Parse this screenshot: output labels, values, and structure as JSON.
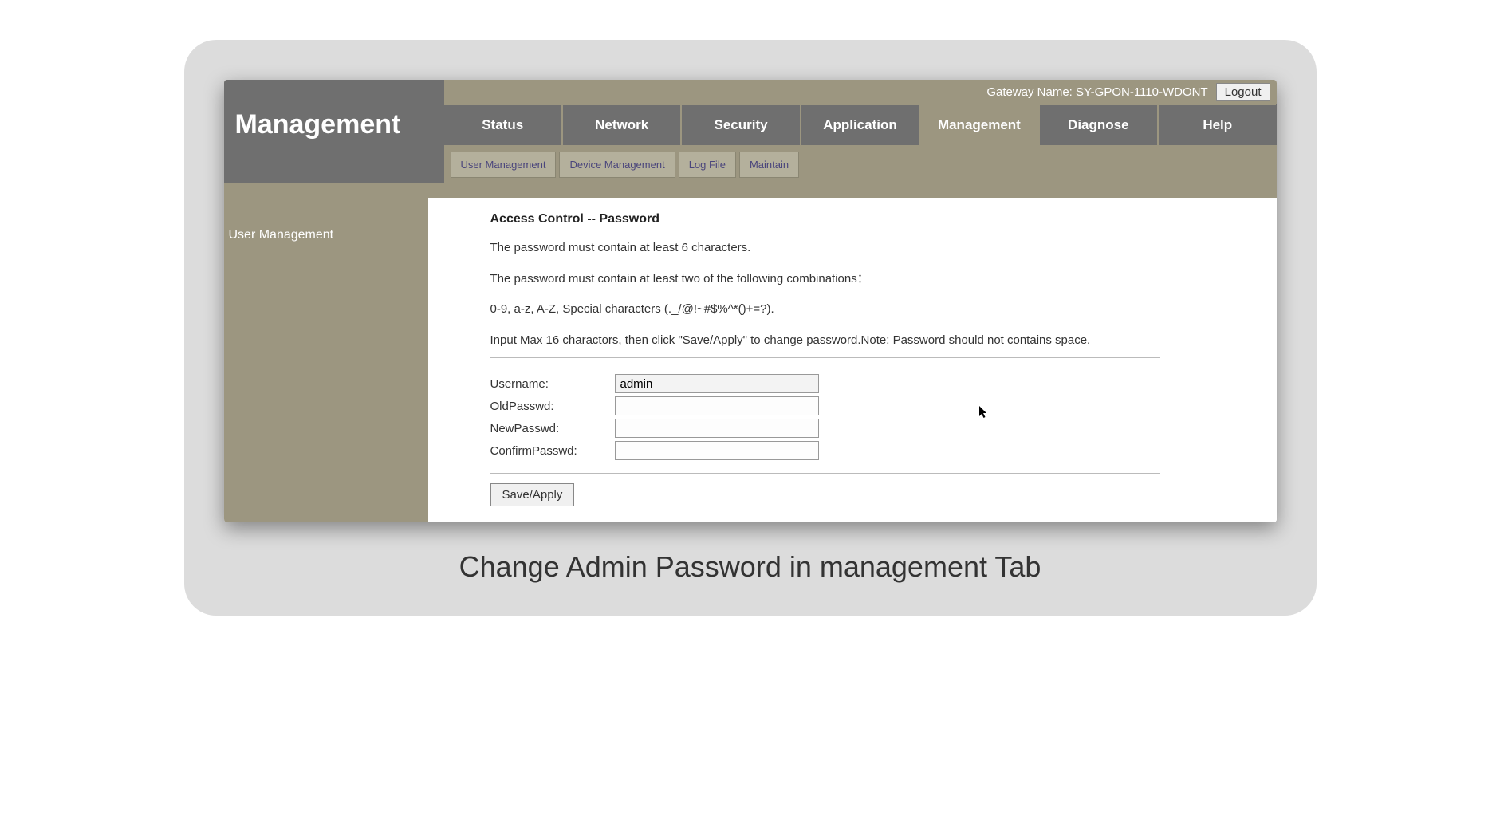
{
  "header": {
    "gateway_label": "Gateway Name: SY-GPON-1110-WDONT",
    "logout": "Logout",
    "title": "Management"
  },
  "main_nav": {
    "status": "Status",
    "network": "Network",
    "security": "Security",
    "application": "Application",
    "management": "Management",
    "diagnose": "Diagnose",
    "help": "Help"
  },
  "sub_nav": {
    "user_management": "User Management",
    "device_management": "Device Management",
    "log_file": "Log File",
    "maintain": "Maintain"
  },
  "sidebar": {
    "user_management": "User Management"
  },
  "content": {
    "section_title": "Access Control -- Password",
    "desc1": "The password must contain at least 6 characters.",
    "desc2": "The password must contain at least two of the following combinations：",
    "desc3": "0-9, a-z, A-Z, Special characters (._/@!~#$%^*()+=?).",
    "desc4": "Input Max 16 charactors, then click \"Save/Apply\" to change password.Note: Password should not contains space.",
    "form": {
      "username_label": "Username:",
      "username_value": "admin",
      "oldpasswd_label": "OldPasswd:",
      "oldpasswd_value": "",
      "newpasswd_label": "NewPasswd:",
      "newpasswd_value": "",
      "confirmpasswd_label": "ConfirmPasswd:",
      "confirmpasswd_value": ""
    },
    "save_button": "Save/Apply"
  },
  "caption": "Change Admin Password in management Tab"
}
